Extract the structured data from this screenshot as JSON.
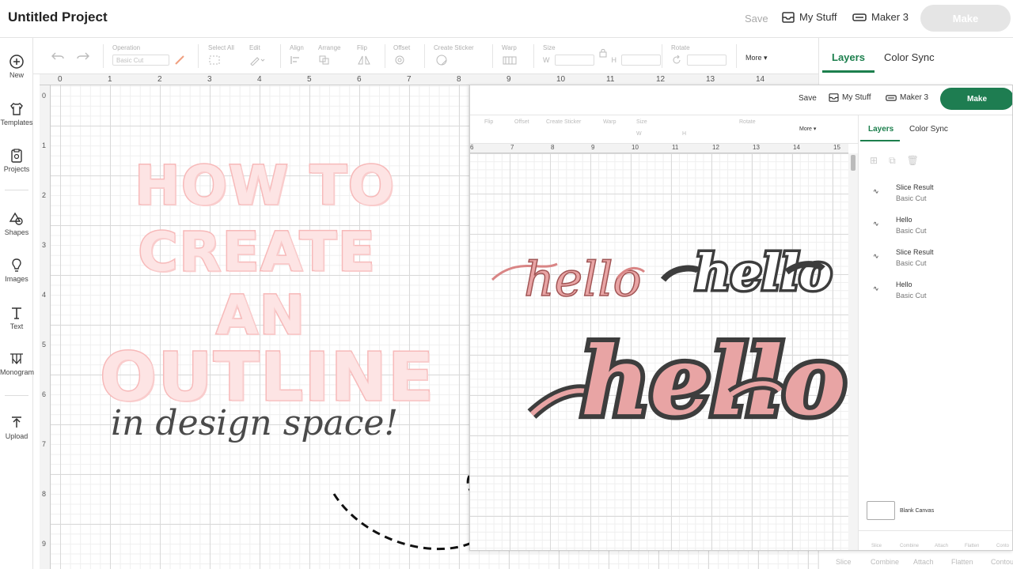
{
  "header": {
    "project_title": "Untitled Project",
    "save_label": "Save",
    "mystuff_label": "My Stuff",
    "machine_label": "Maker 3",
    "make_label": "Make"
  },
  "left_nav": [
    {
      "label": "New",
      "icon": "plus-circle-icon"
    },
    {
      "label": "Templates",
      "icon": "shirt-icon"
    },
    {
      "label": "Projects",
      "icon": "clipboard-icon"
    },
    {
      "label": "Shapes",
      "icon": "shapes-icon"
    },
    {
      "label": "Images",
      "icon": "bulb-icon"
    },
    {
      "label": "Text",
      "icon": "text-icon"
    },
    {
      "label": "Monogram",
      "icon": "monogram-icon"
    },
    {
      "label": "Upload",
      "icon": "upload-icon"
    }
  ],
  "toolbar": {
    "operation_label": "Operation",
    "operation_value": "Basic Cut",
    "select_all": "Select All",
    "edit": "Edit",
    "align": "Align",
    "arrange": "Arrange",
    "flip": "Flip",
    "offset": "Offset",
    "create_sticker": "Create Sticker",
    "warp": "Warp",
    "size": "Size",
    "w": "W",
    "h": "H",
    "rotate": "Rotate",
    "more": "More"
  },
  "right_panel": {
    "layers_tab": "Layers",
    "color_sync_tab": "Color Sync"
  },
  "ruler_h": [
    "0",
    "1",
    "2",
    "3",
    "4",
    "5",
    "6",
    "7",
    "8",
    "9",
    "10",
    "11",
    "12",
    "13",
    "14"
  ],
  "ruler_v": [
    "0",
    "1",
    "2",
    "3",
    "4",
    "5",
    "6",
    "7",
    "8",
    "9"
  ],
  "overlay": {
    "line1": "HOW TO",
    "line2": "CREATE",
    "line3": "AN",
    "line4": "OUTLINE",
    "script": "in design space!"
  },
  "inset": {
    "save_label": "Save",
    "mystuff_label": "My Stuff",
    "machine_label": "Maker 3",
    "make_label": "Make",
    "flip": "Flip",
    "offset": "Offset",
    "create_sticker": "Create Sticker",
    "warp": "Warp",
    "size": "Size",
    "w": "W",
    "h": "H",
    "rotate": "Rotate",
    "more": "More",
    "ruler_h": [
      "6",
      "7",
      "8",
      "9",
      "10",
      "11",
      "12",
      "13",
      "14",
      "15"
    ],
    "layers_tab": "Layers",
    "color_sync_tab": "Color Sync",
    "layers": [
      {
        "name": "Slice Result",
        "op": "Basic Cut"
      },
      {
        "name": "Hello",
        "op": "Basic Cut"
      },
      {
        "name": "Slice Result",
        "op": "Basic Cut"
      },
      {
        "name": "Hello",
        "op": "Basic Cut"
      }
    ],
    "blank_canvas": "Blank Canvas",
    "bottom_actions": [
      "Slice",
      "Combine",
      "Attach",
      "Flatten",
      "Conto"
    ],
    "art": {
      "word": "hello",
      "pink": "#d98585",
      "dark": "#3d3d3d"
    }
  },
  "bottom_actions": [
    "Slice",
    "Combine",
    "Attach",
    "Flatten",
    "Contour"
  ],
  "colors": {
    "accent_green": "#1c7f4d",
    "title_pink": "#f7b9b9",
    "script_gray": "#4a4a4a"
  }
}
